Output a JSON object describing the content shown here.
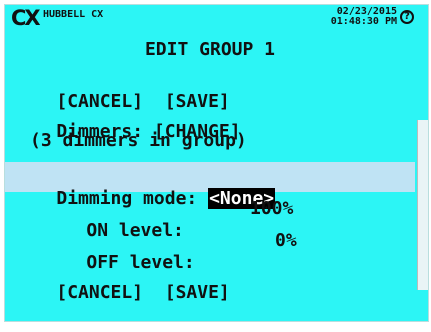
{
  "header": {
    "logo": "CX",
    "brand": "HUBBELL CX",
    "date": "02/23/2015",
    "time": "01:48:30 PM",
    "help_icon": "?"
  },
  "title": "EDIT GROUP 1",
  "top_actions": {
    "cancel": "[CANCEL]",
    "save": "[SAVE]"
  },
  "dimmers": {
    "label": "Dimmers:",
    "change": "[CHANGE]",
    "summary": "(3 dimmers in group)"
  },
  "dimming_mode": {
    "label": "Dimming mode:",
    "value": "<None>"
  },
  "on_level": {
    "label": "ON level:",
    "value": "100%"
  },
  "off_level": {
    "label": "OFF level:",
    "value": "0%"
  },
  "bottom_actions": {
    "cancel": "[CANCEL]",
    "save": "[SAVE]"
  }
}
